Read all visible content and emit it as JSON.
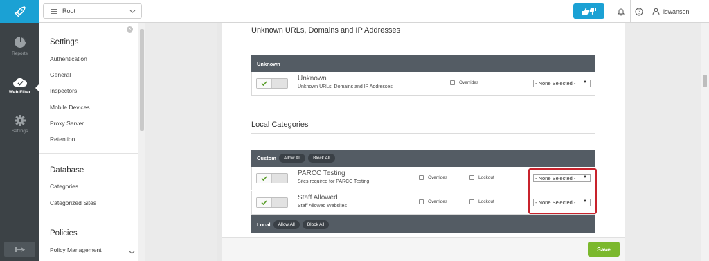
{
  "header": {
    "root_select": "Root",
    "username": "iswanson"
  },
  "leftnav": {
    "items": [
      {
        "label": "Reports",
        "icon": "pie-chart-icon"
      },
      {
        "label": "Web Filter",
        "icon": "cloud-check-icon",
        "active": true
      },
      {
        "label": "Settings",
        "icon": "gear-icon"
      }
    ]
  },
  "sidebar": {
    "settings_heading": "Settings",
    "settings_items": [
      "Authentication",
      "General",
      "Inspectors",
      "Mobile Devices",
      "Proxy Server",
      "Retention"
    ],
    "database_heading": "Database",
    "database_items": [
      "Categories",
      "Categorized Sites"
    ],
    "policies_heading": "Policies",
    "policies_items": [
      "Policy Management"
    ]
  },
  "main": {
    "unknown_section_title": "Unknown URLs, Domains and IP Addresses",
    "unknown_panel": {
      "header": "Unknown",
      "row": {
        "title": "Unknown",
        "subtitle": "Unknown URLs, Domains and IP Addresses",
        "overrides_label": "Overrides",
        "select_value": "- None Selected -"
      }
    },
    "local_section_title": "Local Categories",
    "custom_panel": {
      "header": "Custom",
      "allow_all": "Allow All",
      "block_all": "Block All",
      "rows": [
        {
          "title": "PARCC Testing",
          "subtitle": "Sites required for PARCC Testing",
          "overrides_label": "Overrides",
          "lockout_label": "Lockout",
          "select_value": "- None Selected -"
        },
        {
          "title": "Staff Allowed",
          "subtitle": "Staff Allowed Websites",
          "overrides_label": "Overrides",
          "lockout_label": "Lockout",
          "select_value": "- None Selected -"
        }
      ]
    },
    "local_panel": {
      "header": "Local",
      "allow_all": "Allow All",
      "block_all": "Block All"
    }
  },
  "footer": {
    "save_label": "Save"
  },
  "colors": {
    "brand_blue": "#1ba1d4",
    "nav_dark": "#3c4246",
    "panel_head": "#545c64",
    "save_green": "#7bb82d",
    "highlight_red": "#c8232c"
  }
}
